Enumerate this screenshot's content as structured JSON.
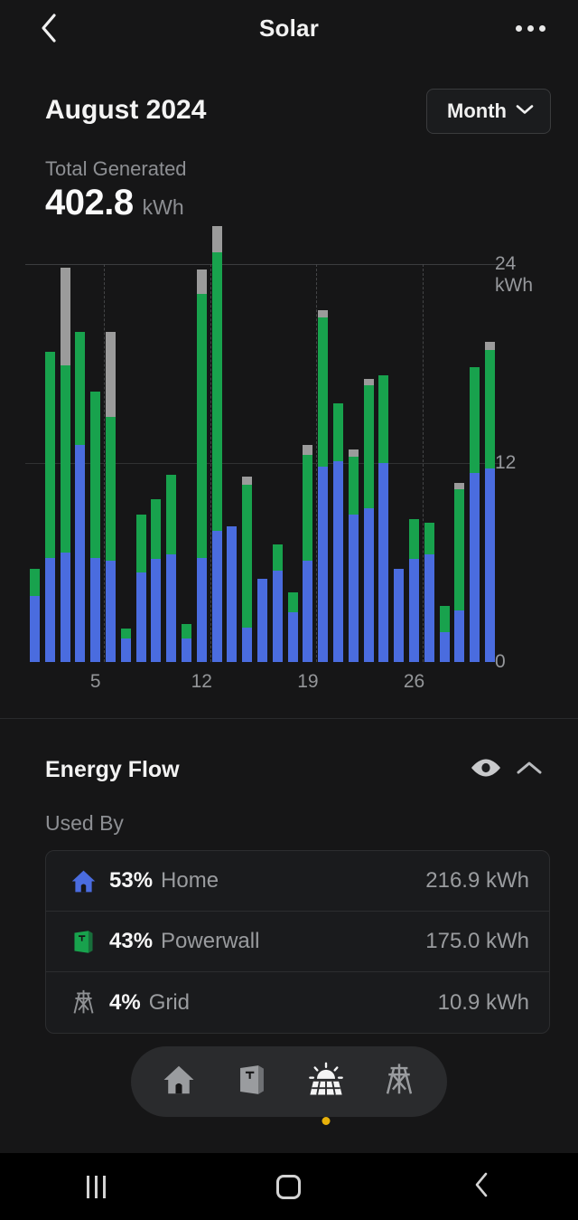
{
  "header": {
    "title": "Solar",
    "back_icon": "chevron-left-icon",
    "more_icon": "overflow-menu-icon"
  },
  "summary": {
    "month_title": "August 2024",
    "period_label": "Month",
    "period_chevron_icon": "chevron-down-icon",
    "total_label": "Total Generated",
    "total_value": "402.8",
    "total_unit": "kWh"
  },
  "colors": {
    "home_blue": "#4a6cdf",
    "powerwall_green": "#18a24d",
    "grid_gray": "#9b9b9b",
    "background": "#161617",
    "accent_dot": "#e8b10a"
  },
  "chart_data": {
    "type": "bar",
    "stacked": true,
    "title": "",
    "xlabel": "",
    "ylabel": "kWh",
    "ylim": [
      0,
      24
    ],
    "yticks": [
      0,
      12,
      24
    ],
    "ytick_labels": [
      "0",
      "12",
      "24\nkWh"
    ],
    "grid": true,
    "legend": [
      "Home",
      "Powerwall",
      "Grid"
    ],
    "legend_position": "none",
    "categories": [
      1,
      2,
      3,
      4,
      5,
      6,
      7,
      8,
      9,
      10,
      11,
      12,
      13,
      14,
      15,
      16,
      17,
      18,
      19,
      20,
      21,
      22,
      23,
      24,
      25,
      26,
      27,
      28,
      29,
      30,
      31
    ],
    "xtick_labels": [
      "5",
      "12",
      "19",
      "26"
    ],
    "xtick_positions": [
      5,
      12,
      19,
      26
    ],
    "series": [
      {
        "name": "Home",
        "color": "#4a6cdf",
        "values": [
          4.0,
          6.3,
          6.6,
          13.1,
          6.3,
          6.1,
          1.4,
          5.4,
          6.2,
          6.5,
          1.4,
          6.3,
          7.9,
          8.2,
          2.1,
          5.0,
          5.5,
          3.0,
          6.1,
          11.8,
          12.1,
          8.9,
          9.3,
          12.0,
          5.6,
          6.2,
          6.5,
          1.8,
          3.1,
          11.4,
          11.7
        ]
      },
      {
        "name": "Powerwall",
        "color": "#18a24d",
        "values": [
          1.6,
          12.4,
          11.3,
          6.8,
          10.0,
          8.7,
          0.6,
          3.5,
          3.6,
          4.8,
          0.9,
          15.9,
          16.8,
          0.0,
          8.6,
          0.0,
          1.6,
          1.2,
          6.4,
          9.0,
          3.5,
          3.5,
          7.4,
          5.3,
          0.0,
          2.4,
          1.9,
          1.6,
          7.3,
          6.4,
          7.1
        ]
      },
      {
        "name": "Grid",
        "color": "#9b9b9b",
        "values": [
          0.0,
          0.0,
          5.9,
          0.0,
          0.0,
          5.1,
          0.0,
          0.0,
          0.0,
          0.0,
          0.0,
          1.5,
          1.6,
          0.0,
          0.5,
          0.0,
          0.0,
          0.0,
          0.6,
          0.4,
          0.0,
          0.4,
          0.4,
          0.0,
          0.0,
          0.0,
          0.0,
          0.0,
          0.4,
          0.0,
          0.5
        ]
      }
    ]
  },
  "energy_flow": {
    "title": "Energy Flow",
    "eye_icon": "eye-icon",
    "collapse_icon": "chevron-up-icon",
    "sub_label": "Used By",
    "rows": [
      {
        "icon": "home-icon",
        "percent": "53%",
        "name": "Home",
        "value": "216.9 kWh"
      },
      {
        "icon": "powerwall-icon",
        "percent": "43%",
        "name": "Powerwall",
        "value": "175.0 kWh"
      },
      {
        "icon": "grid-tower-icon",
        "percent": "4%",
        "name": "Grid",
        "value": "10.9 kWh"
      }
    ]
  },
  "tabbar": {
    "tabs": [
      {
        "icon": "home-icon",
        "active": false
      },
      {
        "icon": "powerwall-icon",
        "active": false
      },
      {
        "icon": "solar-panel-icon",
        "active": true
      },
      {
        "icon": "grid-tower-icon",
        "active": false
      }
    ]
  },
  "android_nav": {
    "recents_icon": "recents-icon",
    "home_icon": "home-square-icon",
    "back_icon": "chevron-left-icon"
  }
}
